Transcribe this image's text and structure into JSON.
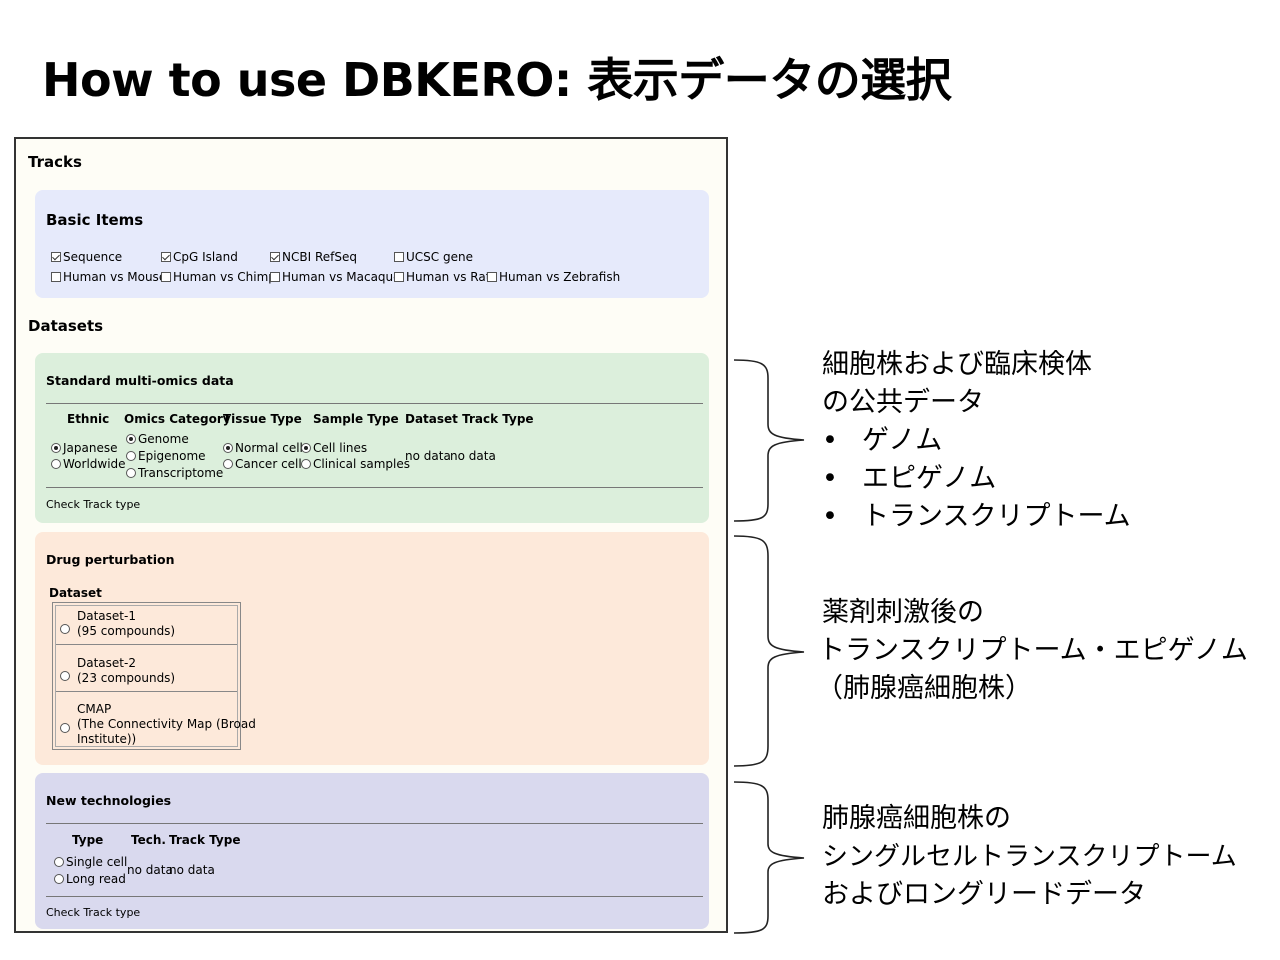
{
  "title": "How to use DBKERO: 表示データの選択",
  "tracks_heading": "Tracks",
  "basic": {
    "title": "Basic Items",
    "items": [
      {
        "label": "Sequence",
        "checked": true
      },
      {
        "label": "CpG Island",
        "checked": true
      },
      {
        "label": "NCBI RefSeq",
        "checked": true
      },
      {
        "label": "UCSC gene",
        "checked": false
      },
      {
        "label": "Human vs Mouse",
        "checked": false
      },
      {
        "label": "Human vs Chimp",
        "checked": false
      },
      {
        "label": "Human vs Macaque",
        "checked": false
      },
      {
        "label": "Human vs Rat",
        "checked": false
      },
      {
        "label": "Human vs Zebrafish",
        "checked": false
      }
    ]
  },
  "datasets_heading": "Datasets",
  "standard": {
    "title": "Standard multi-omics data",
    "headers": [
      "Ethnic",
      "Omics Category",
      "Tissue Type",
      "Sample Type",
      "Dataset Track Type"
    ],
    "ethnic": [
      "Japanese",
      "Worldwide"
    ],
    "omics": [
      "Genome",
      "Epigenome",
      "Transcriptome"
    ],
    "tissue": [
      "Normal cell",
      "Cancer cell"
    ],
    "sample": [
      "Cell lines",
      "Clinical samples"
    ],
    "dataset_value": "no data",
    "track_value": "no data",
    "footer": "Check Track type"
  },
  "drug": {
    "title": "Drug perturbation",
    "dataset_label": "Dataset",
    "datasets": [
      {
        "name": "Dataset-1",
        "desc": "(95 compounds)"
      },
      {
        "name": "Dataset-2",
        "desc": "(23 compounds)"
      },
      {
        "name": "CMAP",
        "desc": "(The Connectivity Map (Broad",
        "desc2": "Institute))"
      }
    ]
  },
  "newtech": {
    "title": "New technologies",
    "headers": [
      "Type",
      "Tech.",
      "Track Type"
    ],
    "types": [
      "Single cell",
      "Long read"
    ],
    "tech_value": "no data",
    "track_value": "no data",
    "footer": "Check Track type"
  },
  "annotations": {
    "a1_line1": "細胞株および臨床検体",
    "a1_line2": "の公共データ",
    "a1_bullets": [
      "ゲノム",
      "エピゲノム",
      "トランスクリプトーム"
    ],
    "a2_line1": "薬剤刺激後の",
    "a2_line2": "トランスクリプトーム・エピゲノム",
    "a2_line3": "（肺腺癌細胞株）",
    "a3_line1": "肺腺癌細胞株の",
    "a3_line2": "シングルセルトランスクリプトーム",
    "a3_line3": "およびロングリードデータ",
    "bullet_char": "•"
  }
}
